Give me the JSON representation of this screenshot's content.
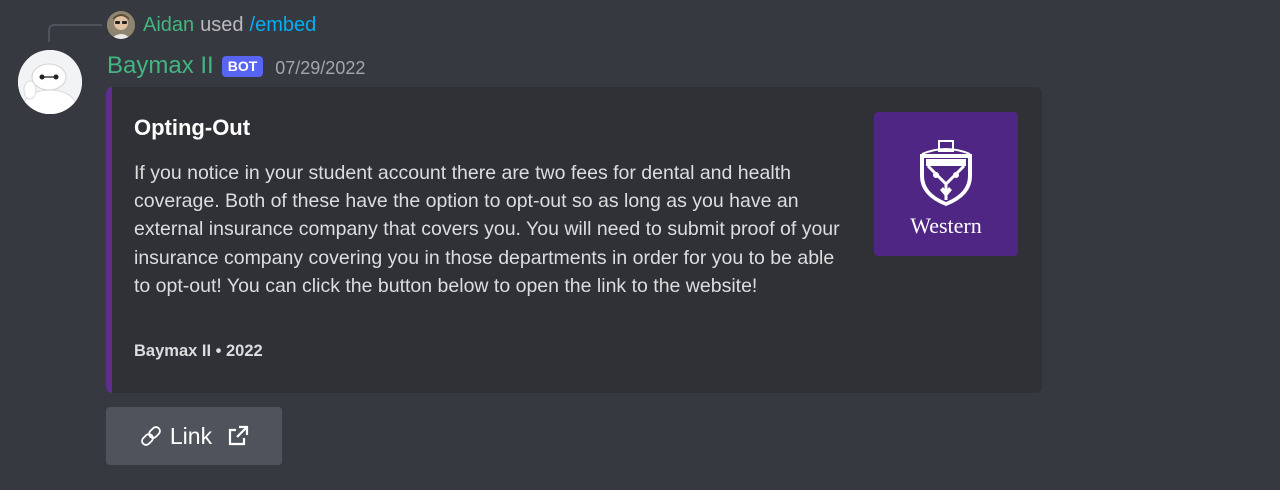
{
  "reply": {
    "user": "Aidan",
    "used_text": "used",
    "command": "/embed"
  },
  "message": {
    "author": "Baymax II",
    "bot_tag": "BOT",
    "timestamp": "07/29/2022"
  },
  "embed": {
    "accent_color": "#5e2e8a",
    "title": "Opting-Out",
    "description": "If you notice in your student account there are two fees for dental and health coverage. Both of these have the option to opt-out so as long as you have an external insurance company that covers you. You will need to submit proof of your insurance company covering you in those departments in order for you to be able to opt-out! You can click the button below to open the link to the website!",
    "footer": "Baymax II • 2022",
    "thumbnail": {
      "icon": "western-crest-icon",
      "text": "Western",
      "background": "#4f2683"
    }
  },
  "button": {
    "label": "Link",
    "left_icon": "link-chain-icon",
    "right_icon": "external-link-icon"
  }
}
